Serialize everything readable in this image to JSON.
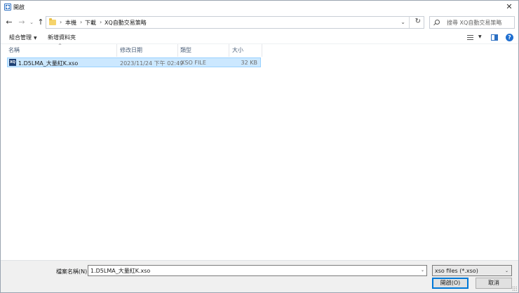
{
  "window": {
    "title": "開啟",
    "close_glyph": "✕"
  },
  "nav": {
    "back_glyph": "←",
    "forward_glyph": "→",
    "recent_glyph": "⌄",
    "up_glyph": "↑",
    "breadcrumbs": [
      "本機",
      "下載",
      "XQ自動交易策略"
    ],
    "separator": "›",
    "dropdown_glyph": "⌄",
    "refresh_glyph": "↻"
  },
  "search": {
    "placeholder": "搜尋 XQ自動交易策略"
  },
  "toolbar": {
    "organize_label": "組合管理",
    "organize_caret": "▼",
    "new_folder_label": "新增資料夾",
    "view_caret": "▼",
    "help_glyph": "?"
  },
  "columns": {
    "name": "名稱",
    "date": "修改日期",
    "type": "類型",
    "size": "大小",
    "sort_glyph": "^"
  },
  "files": [
    {
      "icon_text": "XQ",
      "name": "1.D5LMA_大量紅K.xso",
      "date": "2023/11/24 下午 02:49",
      "type": "XSO FILE",
      "size": "32 KB"
    }
  ],
  "bottom": {
    "filename_label": "檔案名稱(N):",
    "filename_value": "1.D5LMA_大量紅K.xso",
    "filename_caret": "⌄",
    "filter_value": "xso files (*.xso)",
    "filter_caret": "⌄",
    "open_label": "開啟(O)",
    "cancel_label": "取消"
  },
  "colors": {
    "selection_bg": "#cce8ff",
    "selection_border": "#99d1ff",
    "accent": "#0078d7"
  }
}
